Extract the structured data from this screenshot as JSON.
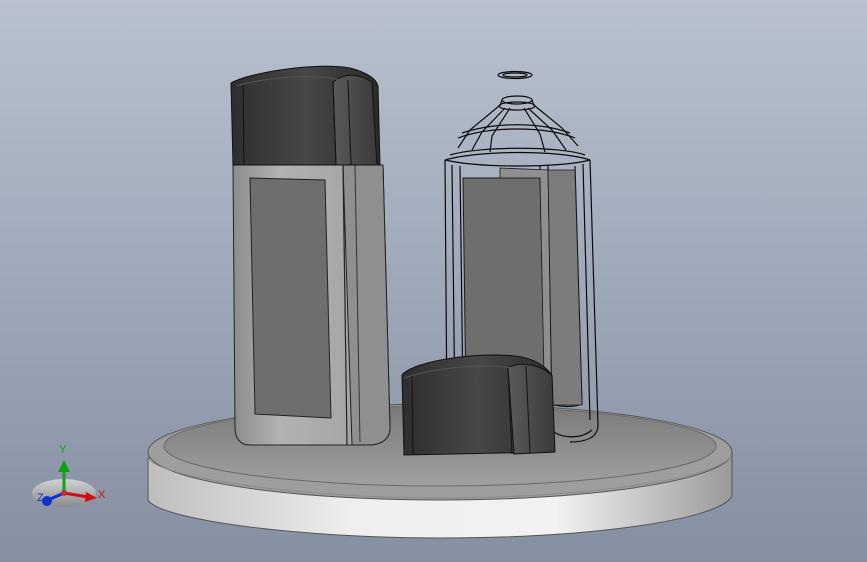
{
  "viewport": {
    "background_top": "#b9c1cf",
    "background_bottom": "#858fa2"
  },
  "colors": {
    "dark_part": "#3c3c3c",
    "light_part": "#a9a9a9",
    "label_panel": "#6e6e6e",
    "base_top": "#8d8d8d",
    "base_side": "#e4e4e4",
    "wireframe": "#0a0a0a"
  },
  "triad": {
    "x_label": "X",
    "y_label": "Y",
    "z_label": "Z",
    "x_color": "#d01010",
    "y_color": "#10a010",
    "z_color": "#1030d0"
  }
}
